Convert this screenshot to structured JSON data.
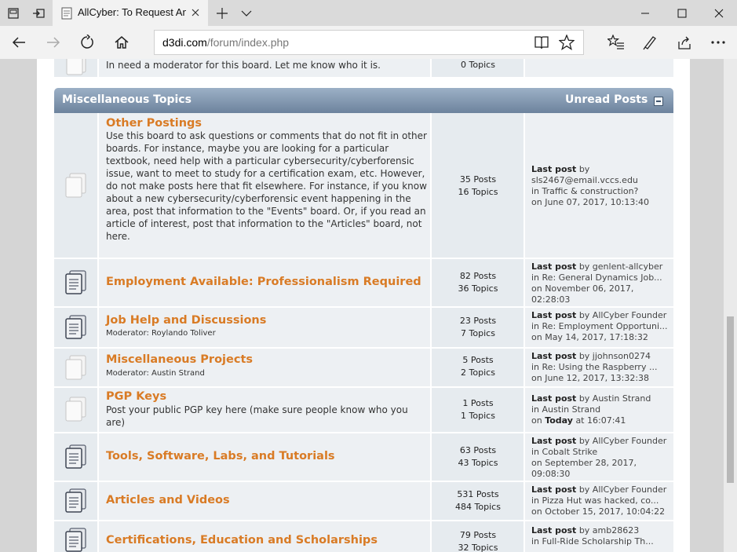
{
  "browser": {
    "tab_title": "AllCyber: To Request An",
    "url_domain": "d3di.com",
    "url_path": "/forum/index.php"
  },
  "top_board": {
    "desc": "In need a moderator for this board. Let me know who it is.",
    "topics": "0 Topics"
  },
  "category": {
    "title": "Miscellaneous Topics",
    "unread_label": "Unread Posts"
  },
  "boards": [
    {
      "title": "Other Postings",
      "desc": "Use this board to ask questions or comments that do not fit in other boards. For instance, maybe you are looking for a particular textbook, need help with a particular cybersecurity/cyberforensic issue, want to meet to study for a certification exam, etc. However, do not make posts here that fit elsewhere. For instance, if you know about a new cybersecurity/cyberforensic event happening in the area, post that information to the \"Events\" board. Or, if you read an article of interest, post that information to the \"Articles\" board, not here.",
      "posts": "35 Posts",
      "topics": "16 Topics",
      "last_post_label": "Last post",
      "last_by": "by",
      "last_author": "sls2467@email.vccs.edu",
      "last_in": "in Traffic & construction?",
      "last_on": "on June 07, 2017, 10:13:40"
    },
    {
      "title": "Employment Available: Professionalism Required",
      "posts": "82 Posts",
      "topics": "36 Topics",
      "last_post_label": "Last post",
      "last_by": "by genlent-allcyber",
      "last_in": "in Re: General Dynamics Job...",
      "last_on": "on November 06, 2017,",
      "last_time": "02:28:03"
    },
    {
      "title": "Job Help and Discussions",
      "moderator": "Moderator: Roylando Toliver",
      "posts": "23 Posts",
      "topics": "7 Topics",
      "last_post_label": "Last post",
      "last_by": "by AllCyber Founder",
      "last_in": "in Re: Employment Opportuni...",
      "last_on": "on May 14, 2017, 17:18:32"
    },
    {
      "title": "Miscellaneous Projects",
      "moderator": "Moderator: Austin Strand",
      "posts": "5 Posts",
      "topics": "2 Topics",
      "last_post_label": "Last post",
      "last_by": "by jjohnson0274",
      "last_in": "in Re: Using the Raspberry ...",
      "last_on": "on June 12, 2017, 13:32:38"
    },
    {
      "title": "PGP Keys",
      "desc": "Post your public PGP key here (make sure people know who you are)",
      "posts": "1 Posts",
      "topics": "1 Topics",
      "last_post_label": "Last post",
      "last_by": "by Austin Strand",
      "last_in": "in Austin Strand",
      "last_on_prefix": "on",
      "last_on_today": "Today",
      "last_on_time": "at 16:07:41"
    },
    {
      "title": "Tools, Software, Labs, and Tutorials",
      "posts": "63 Posts",
      "topics": "43 Topics",
      "last_post_label": "Last post",
      "last_by": "by AllCyber Founder",
      "last_in": "in Cobalt Strike",
      "last_on": "on September 28, 2017,",
      "last_time": "09:08:30"
    },
    {
      "title": "Articles and Videos",
      "posts": "531 Posts",
      "topics": "484 Topics",
      "last_post_label": "Last post",
      "last_by": "by AllCyber Founder",
      "last_in": "in Pizza Hut was hacked, co...",
      "last_on": "on October 15, 2017, 10:04:22"
    },
    {
      "title": "Certifications, Education and Scholarships",
      "posts": "79 Posts",
      "topics": "32 Topics",
      "last_post_label": "Last post",
      "last_by": "by amb28623",
      "last_in": "in Full-Ride Scholarship Th..."
    }
  ]
}
